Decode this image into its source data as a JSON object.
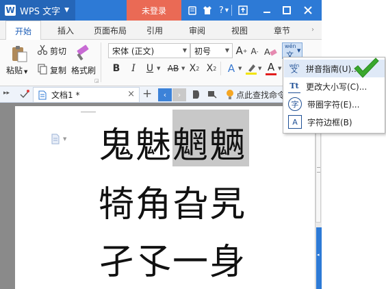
{
  "app": {
    "title": "WPS 文字",
    "logo_letter": "W"
  },
  "titlebar": {
    "login_label": "未登录",
    "help_label": "?"
  },
  "tabs": [
    "开始",
    "插入",
    "页面布局",
    "引用",
    "审阅",
    "视图",
    "章节"
  ],
  "ribbon": {
    "paste": "粘贴",
    "cut": "剪切",
    "copy": "复制",
    "format_painter": "格式刷",
    "font_name": "宋体 (正文)",
    "font_size": "初号",
    "grow_font": "A",
    "shrink_font": "A",
    "bold": "B",
    "italic": "I",
    "underline": "U",
    "strikethrough": "AB",
    "superscript": "X",
    "superscript_mark": "2",
    "subscript": "X",
    "subscript_mark": "2",
    "text_effect": "A",
    "font_color": "A",
    "phonetic_top": "wén",
    "phonetic_bottom": "文"
  },
  "doc_tabs": {
    "tab_name": "文档1 *",
    "close": "×",
    "add": "+",
    "search_hint": "点此查找命令"
  },
  "document": {
    "lines": [
      "鬼魅魍魉",
      "犄角旮旯",
      "孑孓一身"
    ],
    "selected_chars": "魍魉"
  },
  "menu": {
    "items": [
      {
        "icon_text": "wén文",
        "label": "拼音指南(U)...",
        "highlighted": true
      },
      {
        "icon_text": "Tt",
        "label": "更改大小写(C)...",
        "highlighted": false
      },
      {
        "icon_text": "字",
        "label": "带圈字符(E)...",
        "highlighted": false
      },
      {
        "icon_text": "A",
        "label": "字符边框(B)",
        "highlighted": false
      }
    ]
  },
  "colors": {
    "titlebar": "#2d7ad6",
    "login": "#ea6a55",
    "checkmark": "#3aa82e",
    "selection": "#c8c8c8"
  }
}
